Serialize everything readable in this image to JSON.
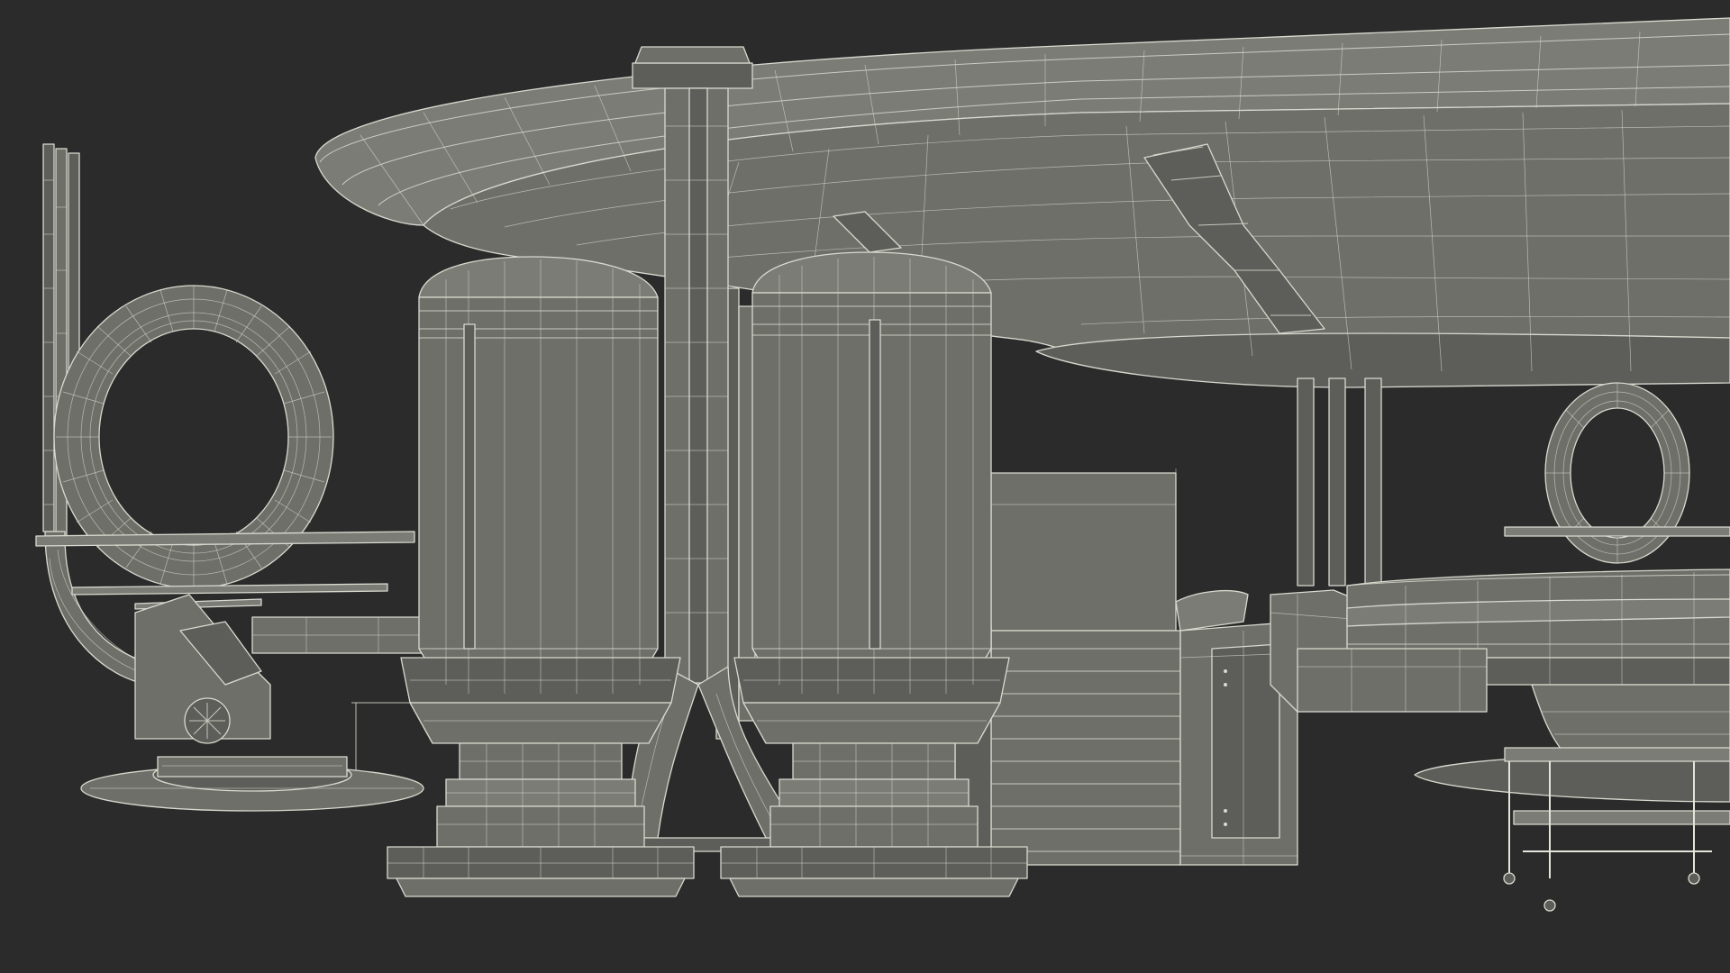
{
  "viewport": {
    "background": "#2b2b2b"
  },
  "palette": {
    "surface": "#6e6f69",
    "surface_dark": "#5d5e59",
    "surface_light": "#7b7c76",
    "wireframe": "#d9d9cf"
  },
  "scene": {
    "style": "grey shaded 3D model with white wireframe overlay",
    "objects": [
      "ceiling-disc",
      "central-pipe-column",
      "left-capsule-tank",
      "right-capsule-tank",
      "left-portal-ring",
      "right-portal-ring",
      "staircase",
      "back-wall-panel",
      "control-console",
      "round-platform",
      "service-cart",
      "left-shelves",
      "vertical-pipes-left"
    ]
  }
}
